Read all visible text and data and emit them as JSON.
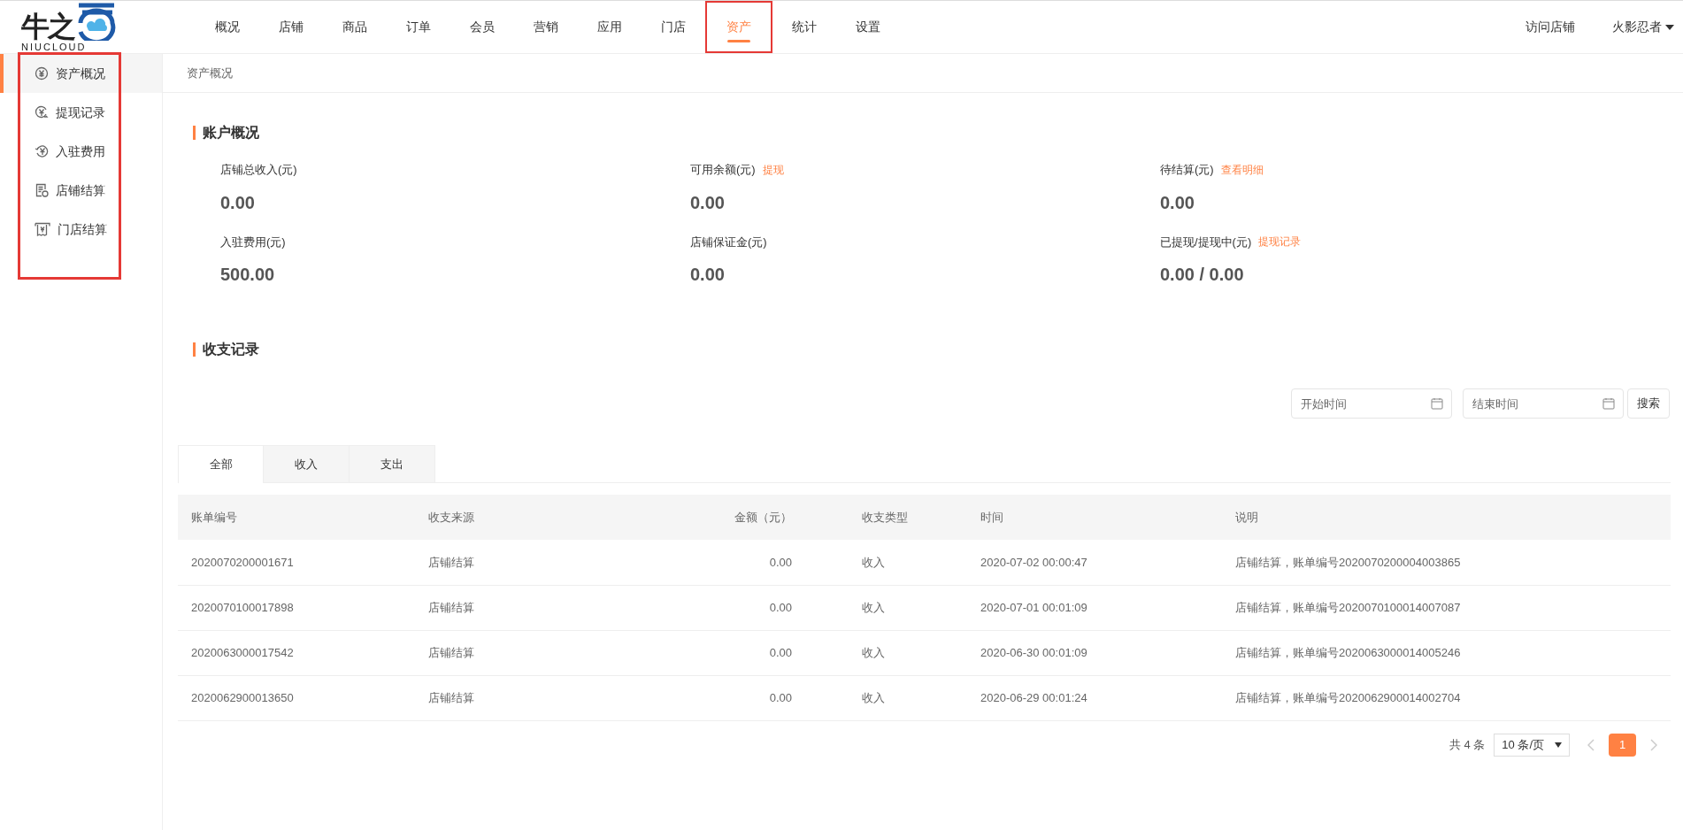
{
  "logo": {
    "text": "牛之",
    "subtext": "NIUCLOUD"
  },
  "nav": {
    "items": [
      {
        "label": "概况",
        "selected": false,
        "annotated": false
      },
      {
        "label": "店铺",
        "selected": false,
        "annotated": false
      },
      {
        "label": "商品",
        "selected": false,
        "annotated": false
      },
      {
        "label": "订单",
        "selected": false,
        "annotated": false
      },
      {
        "label": "会员",
        "selected": false,
        "annotated": false
      },
      {
        "label": "营销",
        "selected": false,
        "annotated": false
      },
      {
        "label": "应用",
        "selected": false,
        "annotated": false
      },
      {
        "label": "门店",
        "selected": false,
        "annotated": false
      },
      {
        "label": "资产",
        "selected": true,
        "annotated": true
      },
      {
        "label": "统计",
        "selected": false,
        "annotated": false
      },
      {
        "label": "设置",
        "selected": false,
        "annotated": false
      }
    ],
    "visit_store": "访问店铺",
    "user": "火影忍者"
  },
  "sidebar": {
    "annotated": true,
    "items": [
      {
        "label": "资产概况",
        "selected": true
      },
      {
        "label": "提现记录",
        "selected": false
      },
      {
        "label": "入驻费用",
        "selected": false
      },
      {
        "label": "店铺结算",
        "selected": false
      },
      {
        "label": "门店结算",
        "selected": false
      }
    ]
  },
  "breadcrumb": "资产概况",
  "account": {
    "title": "账户概况",
    "stats": [
      {
        "label": "店铺总收入(元)",
        "value": "0.00"
      },
      {
        "label": "可用余额(元)",
        "link": "提现",
        "value": "0.00"
      },
      {
        "label": "待结算(元)",
        "link": "查看明细",
        "value": "0.00"
      },
      {
        "label": "入驻费用(元)",
        "value": "500.00"
      },
      {
        "label": "店铺保证金(元)",
        "value": "0.00"
      },
      {
        "label": "已提现/提现中(元)",
        "link": "提现记录",
        "value": "0.00 / 0.00"
      }
    ]
  },
  "records": {
    "title": "收支记录",
    "start_placeholder": "开始时间",
    "end_placeholder": "结束时间",
    "search": "搜索",
    "tabs": [
      {
        "label": "全部",
        "selected": true
      },
      {
        "label": "收入",
        "selected": false
      },
      {
        "label": "支出",
        "selected": false
      }
    ],
    "columns": [
      "账单编号",
      "收支来源",
      "金额（元）",
      "收支类型",
      "时间",
      "说明"
    ],
    "rows": [
      [
        "2020070200001671",
        "店铺结算",
        "0.00",
        "收入",
        "2020-07-02 00:00:47",
        "店铺结算，账单编号2020070200004003865"
      ],
      [
        "2020070100017898",
        "店铺结算",
        "0.00",
        "收入",
        "2020-07-01 00:01:09",
        "店铺结算，账单编号2020070100014007087"
      ],
      [
        "2020063000017542",
        "店铺结算",
        "0.00",
        "收入",
        "2020-06-30 00:01:09",
        "店铺结算，账单编号2020063000014005246"
      ],
      [
        "2020062900013650",
        "店铺结算",
        "0.00",
        "收入",
        "2020-06-29 00:01:24",
        "店铺结算，账单编号2020062900014002704"
      ]
    ],
    "pagination": {
      "total": "共 4 条",
      "page_size": "10 条/页",
      "pages": [
        {
          "label": "1",
          "selected": true
        }
      ]
    }
  }
}
